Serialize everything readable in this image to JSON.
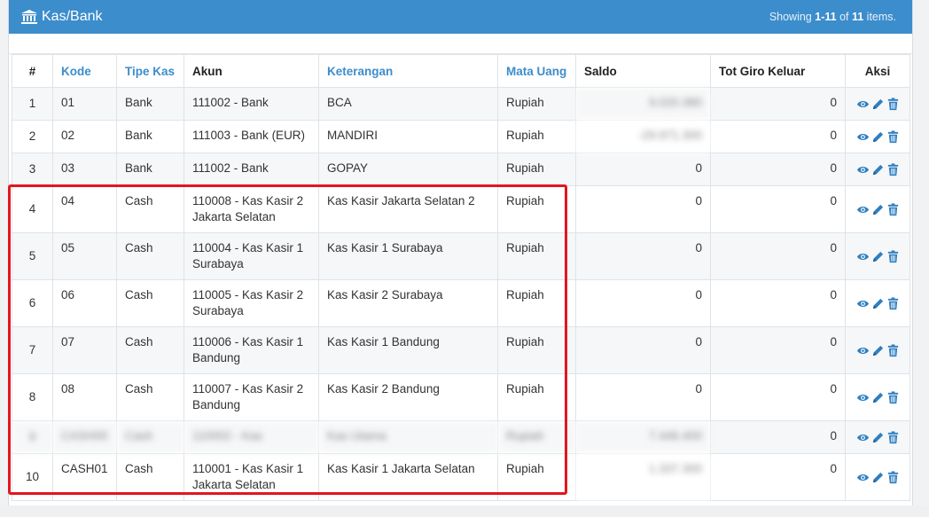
{
  "panel": {
    "title": "Kas/Bank",
    "icon": "bank-icon",
    "summary_prefix": "Showing ",
    "summary_range": "1-11",
    "summary_of": " of ",
    "summary_total": "11",
    "summary_suffix": " items."
  },
  "table": {
    "headers": {
      "no": "#",
      "kode": "Kode",
      "tipe": "Tipe Kas",
      "akun": "Akun",
      "keterangan": "Keterangan",
      "mata_uang": "Mata Uang",
      "saldo": "Saldo",
      "giro": "Tot Giro Keluar",
      "aksi": "Aksi"
    },
    "rows": [
      {
        "no": "1",
        "kode": "01",
        "tipe": "Bank",
        "akun": "111002 - Bank",
        "keterangan": "BCA",
        "mata_uang": "Rupiah",
        "saldo": "9.020.380",
        "giro": "0"
      },
      {
        "no": "2",
        "kode": "02",
        "tipe": "Bank",
        "akun": "111003 - Bank (EUR)",
        "keterangan": "MANDIRI",
        "mata_uang": "Rupiah",
        "saldo": "-29.971.300",
        "giro": "0"
      },
      {
        "no": "3",
        "kode": "03",
        "tipe": "Bank",
        "akun": "111002 - Bank",
        "keterangan": "GOPAY",
        "mata_uang": "Rupiah",
        "saldo": "0",
        "giro": "0"
      },
      {
        "no": "4",
        "kode": "04",
        "tipe": "Cash",
        "akun": "110008 - Kas Kasir 2 Jakarta Selatan",
        "keterangan": "Kas Kasir Jakarta Selatan 2",
        "mata_uang": "Rupiah",
        "saldo": "0",
        "giro": "0"
      },
      {
        "no": "5",
        "kode": "05",
        "tipe": "Cash",
        "akun": "110004 - Kas Kasir 1 Surabaya",
        "keterangan": "Kas Kasir 1 Surabaya",
        "mata_uang": "Rupiah",
        "saldo": "0",
        "giro": "0"
      },
      {
        "no": "6",
        "kode": "06",
        "tipe": "Cash",
        "akun": "110005 - Kas Kasir 2 Surabaya",
        "keterangan": "Kas Kasir 2 Surabaya",
        "mata_uang": "Rupiah",
        "saldo": "0",
        "giro": "0"
      },
      {
        "no": "7",
        "kode": "07",
        "tipe": "Cash",
        "akun": "110006 - Kas Kasir 1 Bandung",
        "keterangan": "Kas Kasir 1 Bandung",
        "mata_uang": "Rupiah",
        "saldo": "0",
        "giro": "0"
      },
      {
        "no": "8",
        "kode": "08",
        "tipe": "Cash",
        "akun": "110007 - Kas Kasir 2 Bandung",
        "keterangan": "Kas Kasir 2 Bandung",
        "mata_uang": "Rupiah",
        "saldo": "0",
        "giro": "0"
      },
      {
        "no": "9",
        "kode": "CASH00",
        "tipe": "Cash",
        "akun": "110002 - Kas",
        "keterangan": "Kas Utama",
        "mata_uang": "Rupiah",
        "saldo": "7.446.400",
        "giro": "0"
      },
      {
        "no": "10",
        "kode": "CASH01",
        "tipe": "Cash",
        "akun": "110001 - Kas Kasir 1 Jakarta Selatan",
        "keterangan": "Kas Kasir 1 Jakarta Selatan",
        "mata_uang": "Rupiah",
        "saldo": "1.337.300",
        "giro": "0"
      }
    ],
    "blurred_saldo_rows": [
      0,
      1,
      8,
      9
    ],
    "blurred_full_rows": [
      8
    ]
  },
  "colors": {
    "header_bg": "#3c8dcc",
    "link_header": "#3c8dcc",
    "action_icon": "#2f7fc1",
    "highlight": "#e3161e"
  },
  "actions": [
    "view-icon",
    "edit-icon",
    "delete-icon"
  ]
}
